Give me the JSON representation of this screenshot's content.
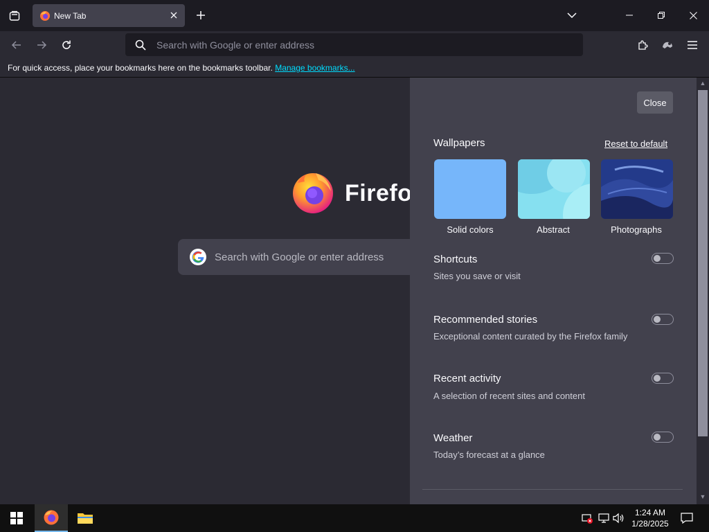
{
  "tab": {
    "title": "New Tab"
  },
  "navbar": {
    "url_placeholder": "Search with Google or enter address"
  },
  "bookmarks_bar": {
    "text": "For quick access, place your bookmarks here on the bookmarks toolbar.",
    "link": "Manage bookmarks..."
  },
  "ntp": {
    "wordmark": "Firefox",
    "search_placeholder": "Search with Google or enter address"
  },
  "customize_panel": {
    "close_label": "Close",
    "wallpapers_title": "Wallpapers",
    "reset_label": "Reset to default",
    "wallpaper_options": [
      "Solid colors",
      "Abstract",
      "Photographs"
    ],
    "sections": [
      {
        "title": "Shortcuts",
        "subtitle": "Sites you save or visit",
        "enabled": false
      },
      {
        "title": "Recommended stories",
        "subtitle": "Exceptional content curated by the Firefox family",
        "enabled": false
      },
      {
        "title": "Recent activity",
        "subtitle": "A selection of recent sites and content",
        "enabled": false
      },
      {
        "title": "Weather",
        "subtitle": "Today’s forecast at a glance",
        "enabled": false
      }
    ]
  },
  "taskbar": {
    "time": "1:24 AM",
    "date": "1/28/2025"
  },
  "colors": {
    "accent_link": "#00ddff",
    "panel_bg": "#42414d",
    "page_bg": "#2b2a33"
  }
}
